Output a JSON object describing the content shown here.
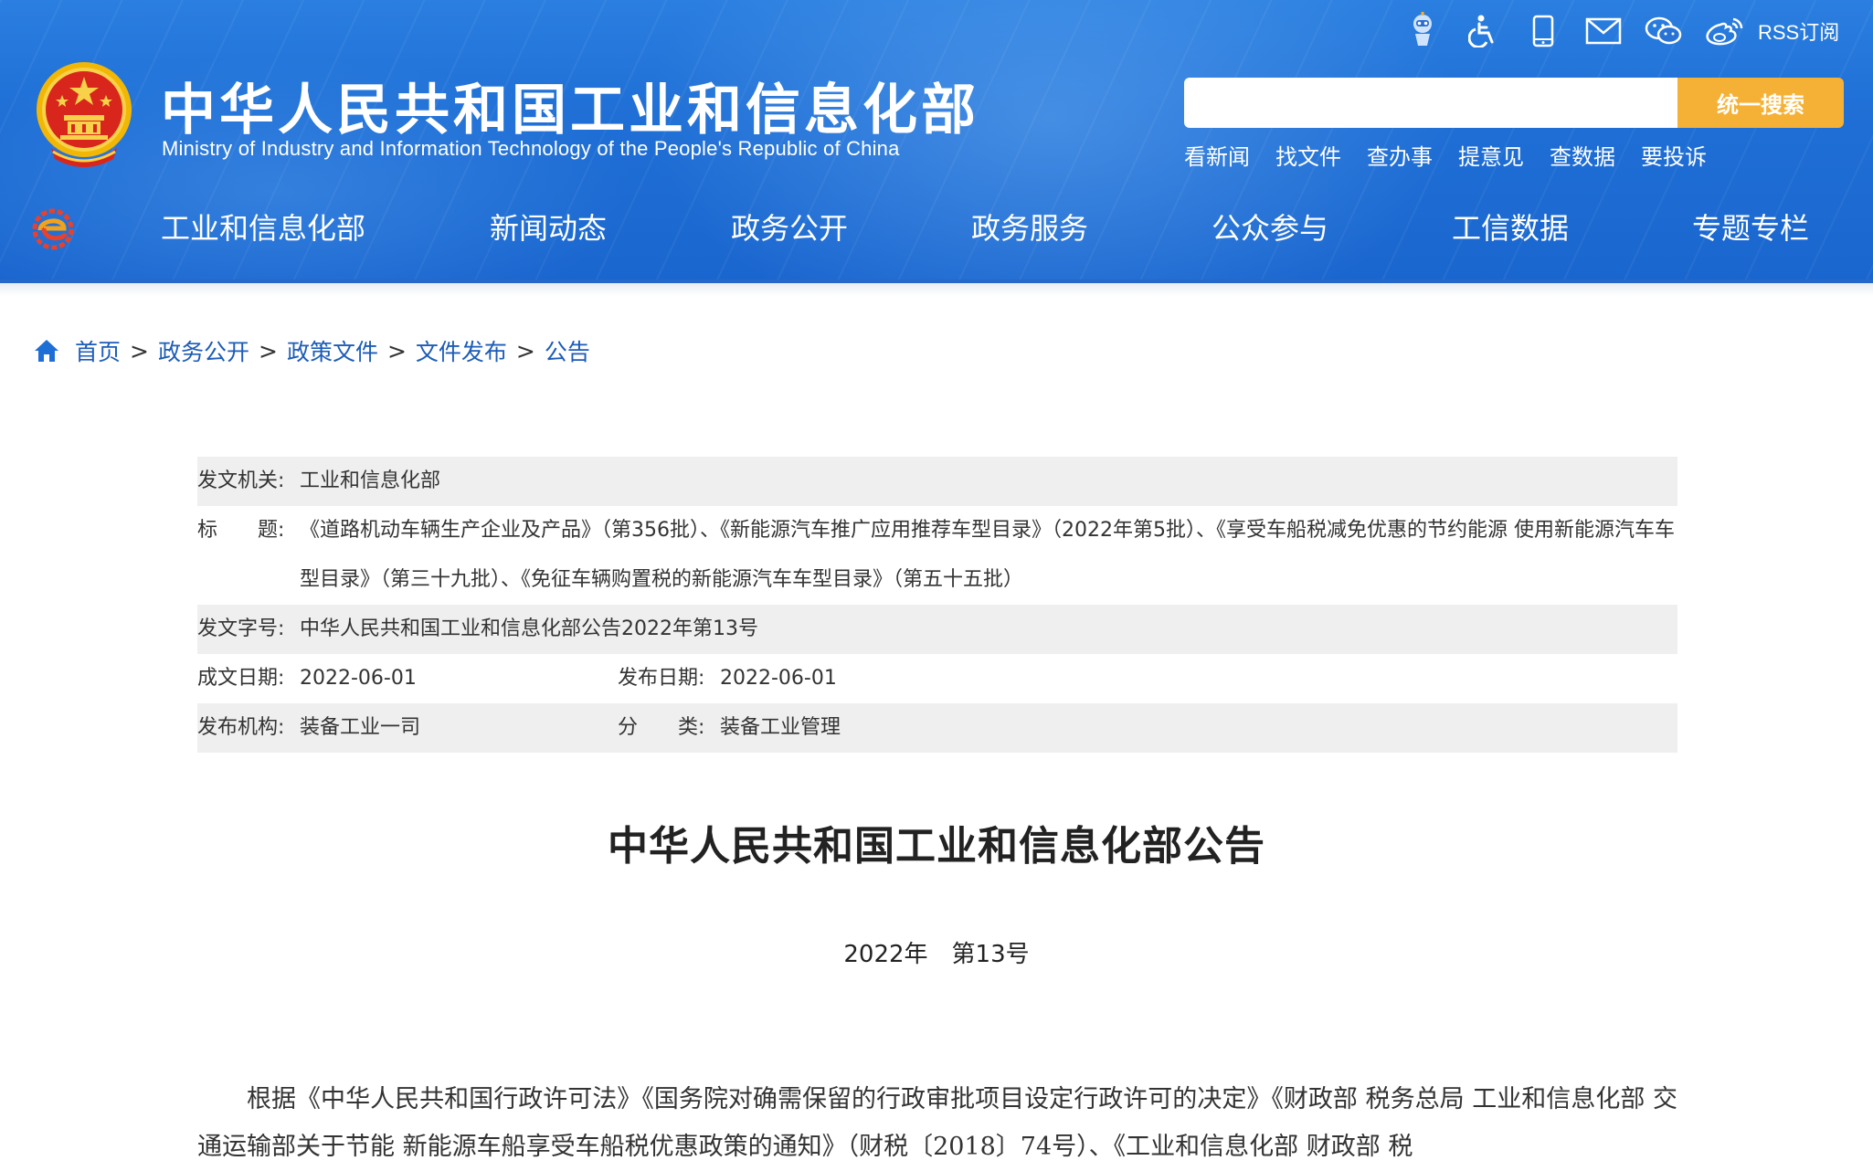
{
  "header": {
    "title": "中华人民共和国工业和信息化部",
    "subtitle": "Ministry of Industry and Information Technology of the People's Republic of China",
    "top_icons": [
      "robot-assistant-icon",
      "accessibility-icon",
      "mobile-icon",
      "mail-icon",
      "wechat-icon",
      "weibo-icon"
    ],
    "rss_label": "RSS订阅",
    "search": {
      "placeholder": "",
      "button_label": "统一搜索"
    },
    "quick_links": [
      "看新闻",
      "找文件",
      "查办事",
      "提意见",
      "查数据",
      "要投诉"
    ],
    "nav": [
      "工业和信息化部",
      "新闻动态",
      "政务公开",
      "政务服务",
      "公众参与",
      "工信数据",
      "专题专栏"
    ]
  },
  "breadcrumb": [
    "首页",
    "政务公开",
    "政策文件",
    "文件发布",
    "公告"
  ],
  "info": {
    "issuer_label": "发文机关:",
    "issuer": "工业和信息化部",
    "title_label": "标　　题:",
    "title": "《道路机动车辆生产企业及产品》（第356批）、《新能源汽车推广应用推荐车型目录》（2022年第5批）、《享受车船税减免优惠的节约能源 使用新能源汽车车型目录》（第三十九批）、《免征车辆购置税的新能源汽车车型目录》（第五十五批）",
    "doc_no_label": "发文字号:",
    "doc_no": "中华人民共和国工业和信息化部公告2022年第13号",
    "written_date_label": "成文日期:",
    "written_date": "2022-06-01",
    "publish_date_label": "发布日期:",
    "publish_date": "2022-06-01",
    "org_label": "发布机构:",
    "org": "装备工业一司",
    "category_label": "分　　类:",
    "category": "装备工业管理"
  },
  "article": {
    "title": "中华人民共和国工业和信息化部公告",
    "year": "2022年",
    "number": "第13号",
    "body": "根据《中华人民共和国行政许可法》《国务院对确需保留的行政审批项目设定行政许可的决定》《财政部 税务总局 工业和信息化部 交通运输部关于节能 新能源车船享受车船税优惠政策的通知》（财税〔2018〕74号）、《工业和信息化部 财政部 税"
  },
  "colors": {
    "header_blue": "#1f6fd6",
    "search_button": "#f5b136",
    "breadcrumb_link": "#1d5cb8",
    "info_row_gray": "#efefef"
  }
}
